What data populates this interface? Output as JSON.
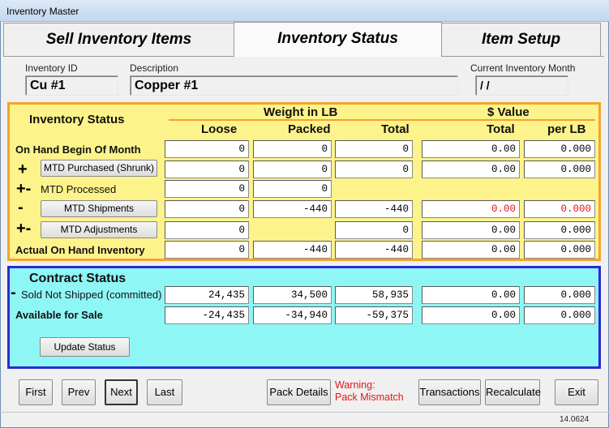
{
  "window": {
    "title": "Inventory Master"
  },
  "tabs": [
    {
      "label": "Sell Inventory Items",
      "active": false
    },
    {
      "label": "Inventory Status",
      "active": true
    },
    {
      "label": "Item Setup",
      "active": false
    }
  ],
  "header": {
    "inventory_id_label": "Inventory ID",
    "inventory_id_value": "Cu #1",
    "description_label": "Description",
    "description_value": "Copper #1",
    "month_label": "Current Inventory Month",
    "month_value": " / /"
  },
  "inventory_status": {
    "title": "Inventory Status",
    "weight_group": "Weight in LB",
    "value_group": "$ Value",
    "columns": [
      "Loose",
      "Packed",
      "Total",
      "Total",
      "per LB"
    ],
    "rows": [
      {
        "sign": "",
        "label": "On Hand Begin Of Month",
        "button": false,
        "cells": [
          "0",
          "0",
          "0",
          "0.00",
          "0.000"
        ]
      },
      {
        "sign": "+",
        "label": "MTD Purchased (Shrunk)",
        "button": true,
        "cells": [
          "0",
          "0",
          "0",
          "0.00",
          "0.000"
        ]
      },
      {
        "sign": "+-",
        "label": "MTD Processed",
        "button": false,
        "cells": [
          "0",
          "0",
          null,
          null,
          null
        ]
      },
      {
        "sign": "-",
        "label": "MTD Shipments",
        "button": true,
        "cells": [
          "0",
          "-440",
          "-440",
          "0.00",
          "0.000"
        ]
      },
      {
        "sign": "+-",
        "label": "MTD Adjustments",
        "button": true,
        "cells": [
          "0",
          null,
          "0",
          "0.00",
          "0.000"
        ]
      },
      {
        "sign": "",
        "label": "Actual On Hand Inventory",
        "button": false,
        "cells": [
          "0",
          "-440",
          "-440",
          "0.00",
          "0.000"
        ]
      }
    ]
  },
  "contract_status": {
    "title": "Contract Status",
    "rows": [
      {
        "sign": "-",
        "label": "Sold Not Shipped (committed)",
        "cells": [
          "24,435",
          "34,500",
          "58,935",
          "0.00",
          "0.000"
        ]
      },
      {
        "sign": "",
        "label": "Available for Sale",
        "cells": [
          "-24,435",
          "-34,940",
          "-59,375",
          "0.00",
          "0.000"
        ]
      }
    ],
    "update_button": "Update Status"
  },
  "footer": {
    "first": "First",
    "prev": "Prev",
    "next": "Next",
    "last": "Last",
    "pack_details": "Pack Details",
    "warning_line1": "Warning:",
    "warning_line2": "Pack Mismatch",
    "transactions": "Transactions",
    "recalculate": "Recalculate",
    "exit": "Exit",
    "version": "14.0624"
  },
  "colors": {
    "inventory_panel_bg": "#fdf38b",
    "inventory_panel_border": "#f3a32f",
    "contract_panel_bg": "#8ff6f6",
    "contract_panel_border": "#2a2ad2",
    "negative_value_text": "#e01818"
  }
}
